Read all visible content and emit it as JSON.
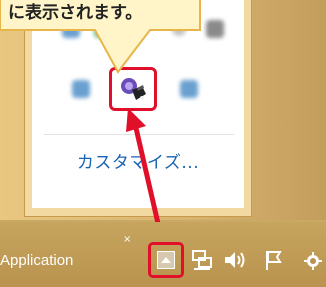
{
  "callout": {
    "text": "に表示されます。"
  },
  "tray_popup": {
    "customize_label": "カスタマイズ..."
  },
  "taskbar": {
    "app_label": "Application",
    "close_glyph": "×"
  },
  "icons": {
    "network": "network-icon",
    "volume": "volume-icon",
    "flag": "action-center-flag-icon",
    "app": "app-tray-icon"
  },
  "colors": {
    "highlight": "#e0102a",
    "link": "#1a63b4",
    "arrow": "#e0102a"
  }
}
